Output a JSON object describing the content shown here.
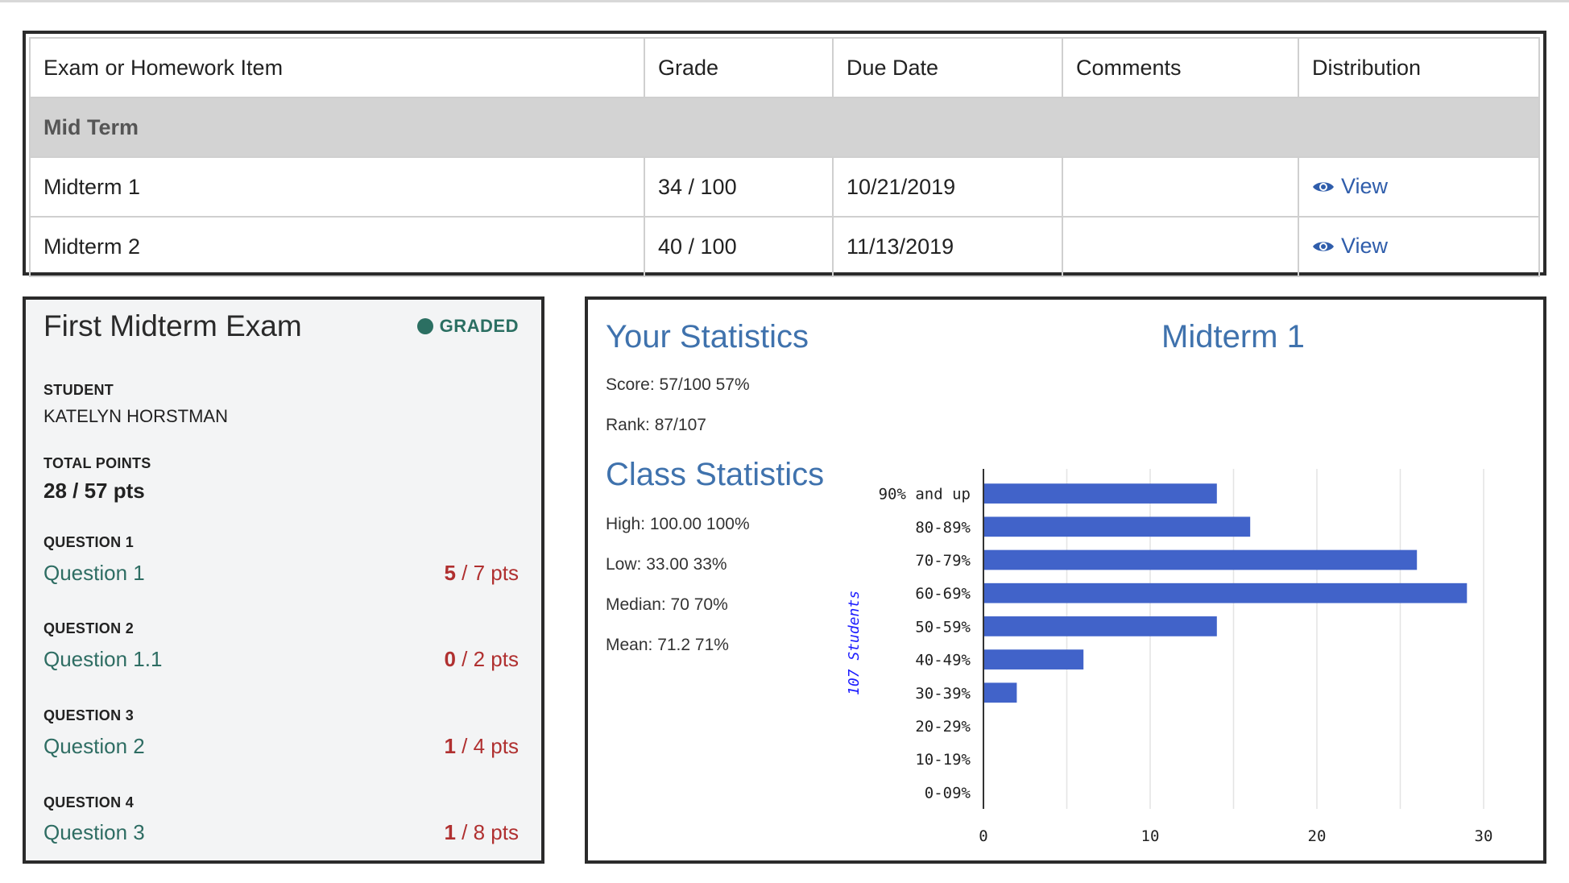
{
  "grades_table": {
    "headers": [
      "Exam or Homework Item",
      "Grade",
      "Due Date",
      "Comments",
      "Distribution"
    ],
    "section": "Mid Term",
    "rows": [
      {
        "item": "Midterm 1",
        "grade": "34 / 100",
        "due": "10/21/2019",
        "comments": "",
        "distribution": "View"
      },
      {
        "item": "Midterm 2",
        "grade": "40 / 100",
        "due": "11/13/2019",
        "comments": "",
        "distribution": "View"
      }
    ],
    "view_icon": "eye-icon",
    "link_color": "#2f5dab"
  },
  "submission": {
    "title": "First Midterm Exam",
    "status": "GRADED",
    "status_color": "#2b6f62",
    "student_label": "STUDENT",
    "student_name": "KATELYN HORSTMAN",
    "total_label": "TOTAL POINTS",
    "total_value": "28 / 57 pts",
    "questions": [
      {
        "label": "QUESTION 1",
        "link": "Question 1",
        "earned": "5",
        "rest": " / 7 pts"
      },
      {
        "label": "QUESTION 2",
        "link": "Question 1.1",
        "earned": "0",
        "rest": " / 2 pts"
      },
      {
        "label": "QUESTION 3",
        "link": "Question 2",
        "earned": "1",
        "rest": " / 4 pts"
      },
      {
        "label": "QUESTION 4",
        "link": "Question 3",
        "earned": "1",
        "rest": " / 8 pts"
      }
    ]
  },
  "statistics": {
    "your_heading": "Your Statistics",
    "chart_heading": "Midterm 1",
    "score": "Score: 57/100 57%",
    "rank": "Rank: 87/107",
    "class_heading": "Class Statistics",
    "high": "High: 100.00 100%",
    "low": "Low: 33.00 33%",
    "median": "Median: 70 70%",
    "mean": "Mean: 71.2 71%",
    "heading_color": "#3f72ad"
  },
  "chart_data": {
    "type": "bar",
    "orientation": "horizontal",
    "categories": [
      "90% and up",
      "80-89%",
      "70-79%",
      "60-69%",
      "50-59%",
      "40-49%",
      "30-39%",
      "20-29%",
      "10-19%",
      "0-09%"
    ],
    "values": [
      14,
      16,
      26,
      29,
      14,
      6,
      2,
      0,
      0,
      0
    ],
    "ylabel": "107 Students",
    "xlim": [
      0,
      30
    ],
    "xticks": [
      0,
      10,
      20,
      30
    ],
    "grid": true,
    "bar_color": "#4163c9"
  }
}
